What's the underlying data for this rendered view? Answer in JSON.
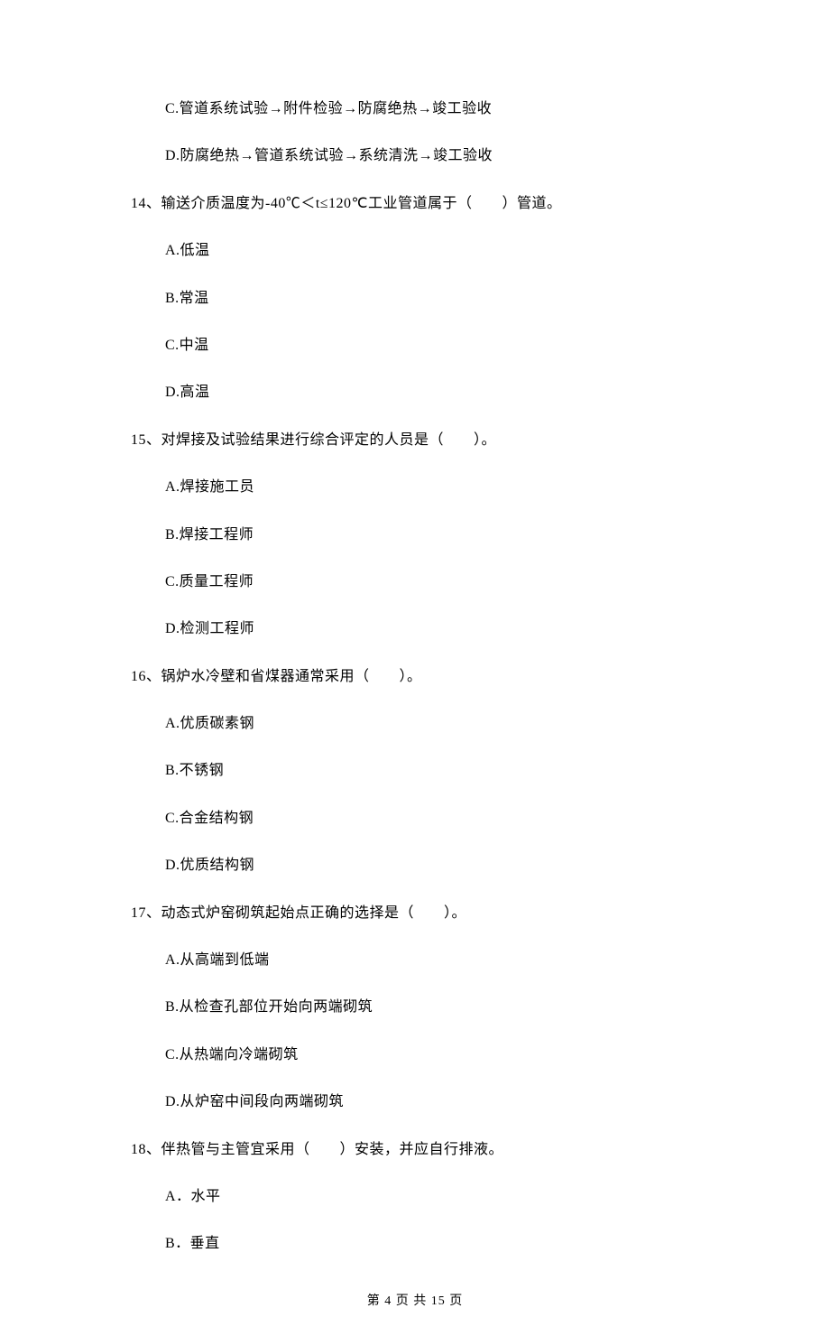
{
  "lines": {
    "opt_C_prev1": "C.管道系统试验→附件检验→防腐绝热→竣工验收",
    "opt_D_prev1": "D.防腐绝热→管道系统试验→系统清洗→竣工验收",
    "q14": "14、输送介质温度为-40℃＜t≤120℃工业管道属于（　　）管道。",
    "q14_A": "A.低温",
    "q14_B": "B.常温",
    "q14_C": "C.中温",
    "q14_D": "D.高温",
    "q15": "15、对焊接及试验结果进行综合评定的人员是（　　）。",
    "q15_A": "A.焊接施工员",
    "q15_B": "B.焊接工程师",
    "q15_C": "C.质量工程师",
    "q15_D": "D.检测工程师",
    "q16": "16、锅炉水冷壁和省煤器通常采用（　　）。",
    "q16_A": "A.优质碳素钢",
    "q16_B": "B.不锈钢",
    "q16_C": "C.合金结构钢",
    "q16_D": "D.优质结构钢",
    "q17": "17、动态式炉窑砌筑起始点正确的选择是（　　）。",
    "q17_A": "A.从高端到低端",
    "q17_B": "B.从检查孔部位开始向两端砌筑",
    "q17_C": "C.从热端向冷端砌筑",
    "q17_D": "D.从炉窑中间段向两端砌筑",
    "q18": "18、伴热管与主管宜采用（　　）安装，并应自行排液。",
    "q18_A": "A．水平",
    "q18_B": "B．垂直"
  },
  "footer": "第 4 页 共 15 页"
}
